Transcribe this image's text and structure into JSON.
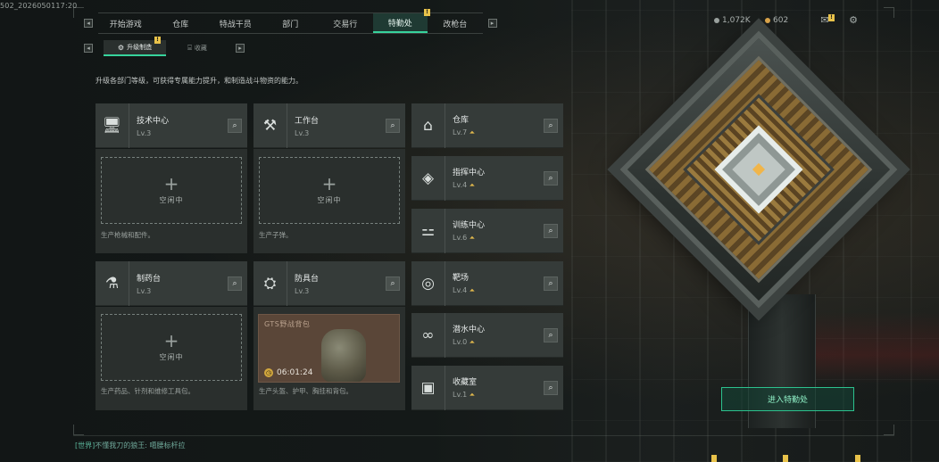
{
  "build_id": "502_2026050117:20",
  "nav": {
    "left_key": "◂",
    "right_key": "▸",
    "tabs": [
      {
        "label": "开始游戏"
      },
      {
        "label": "仓库"
      },
      {
        "label": "特战干员"
      },
      {
        "label": "部门"
      },
      {
        "label": "交易行"
      },
      {
        "label": "特勤处",
        "active": true
      },
      {
        "label": "改枪台"
      }
    ]
  },
  "subnav": {
    "tabs": [
      {
        "label": "升级制造",
        "active": true
      },
      {
        "label": "收藏"
      }
    ]
  },
  "description": "升级各部门等级，可获得专属能力提升，和制造战斗物资的能力。",
  "resources": {
    "currency1": "1,072K",
    "currency2": "602",
    "currency1_color": "#9aa19e",
    "currency2_color": "#d8a24a"
  },
  "large_cards": [
    {
      "name": "技术中心",
      "level": "Lv.3",
      "icon": "computer-icon",
      "slot_label": "空闲中",
      "note": "生产枪械和配件。"
    },
    {
      "name": "工作台",
      "level": "Lv.3",
      "icon": "tools-icon",
      "slot_label": "空闲中",
      "note": "生产子弹。"
    },
    {
      "name": "制药台",
      "level": "Lv.3",
      "icon": "microscope-icon",
      "slot_label": "空闲中",
      "note": "生产药品、针剂和维修工具包。"
    },
    {
      "name": "防具台",
      "level": "Lv.3",
      "icon": "armor-icon",
      "product_name": "GTS野战背包",
      "timer": "06:01:24",
      "note": "生产头盔、护甲、胸挂和背包。"
    }
  ],
  "small_cards": [
    {
      "name": "仓库",
      "level": "Lv.7",
      "icon": "warehouse-icon",
      "upgrade": true
    },
    {
      "name": "指挥中心",
      "level": "Lv.4",
      "icon": "command-icon",
      "upgrade": true
    },
    {
      "name": "训练中心",
      "level": "Lv.6",
      "icon": "dumbbell-icon",
      "upgrade": true
    },
    {
      "name": "靶场",
      "level": "Lv.4",
      "icon": "target-icon",
      "upgrade": true
    },
    {
      "name": "潜水中心",
      "level": "Lv.0",
      "icon": "diving-mask-icon",
      "upgrade": true
    },
    {
      "name": "收藏室",
      "level": "Lv.1",
      "icon": "collection-icon",
      "upgrade": true
    }
  ],
  "enter_button": "进入特勤处",
  "chat": {
    "channel": "[世界]",
    "message": "不懂我刀的狼王: 噶腰标杆拉"
  },
  "colors": {
    "accent": "#37d39c",
    "badge": "#e8c24a",
    "card": "#353b39",
    "upgrade_arrow": "#e0b84c"
  }
}
